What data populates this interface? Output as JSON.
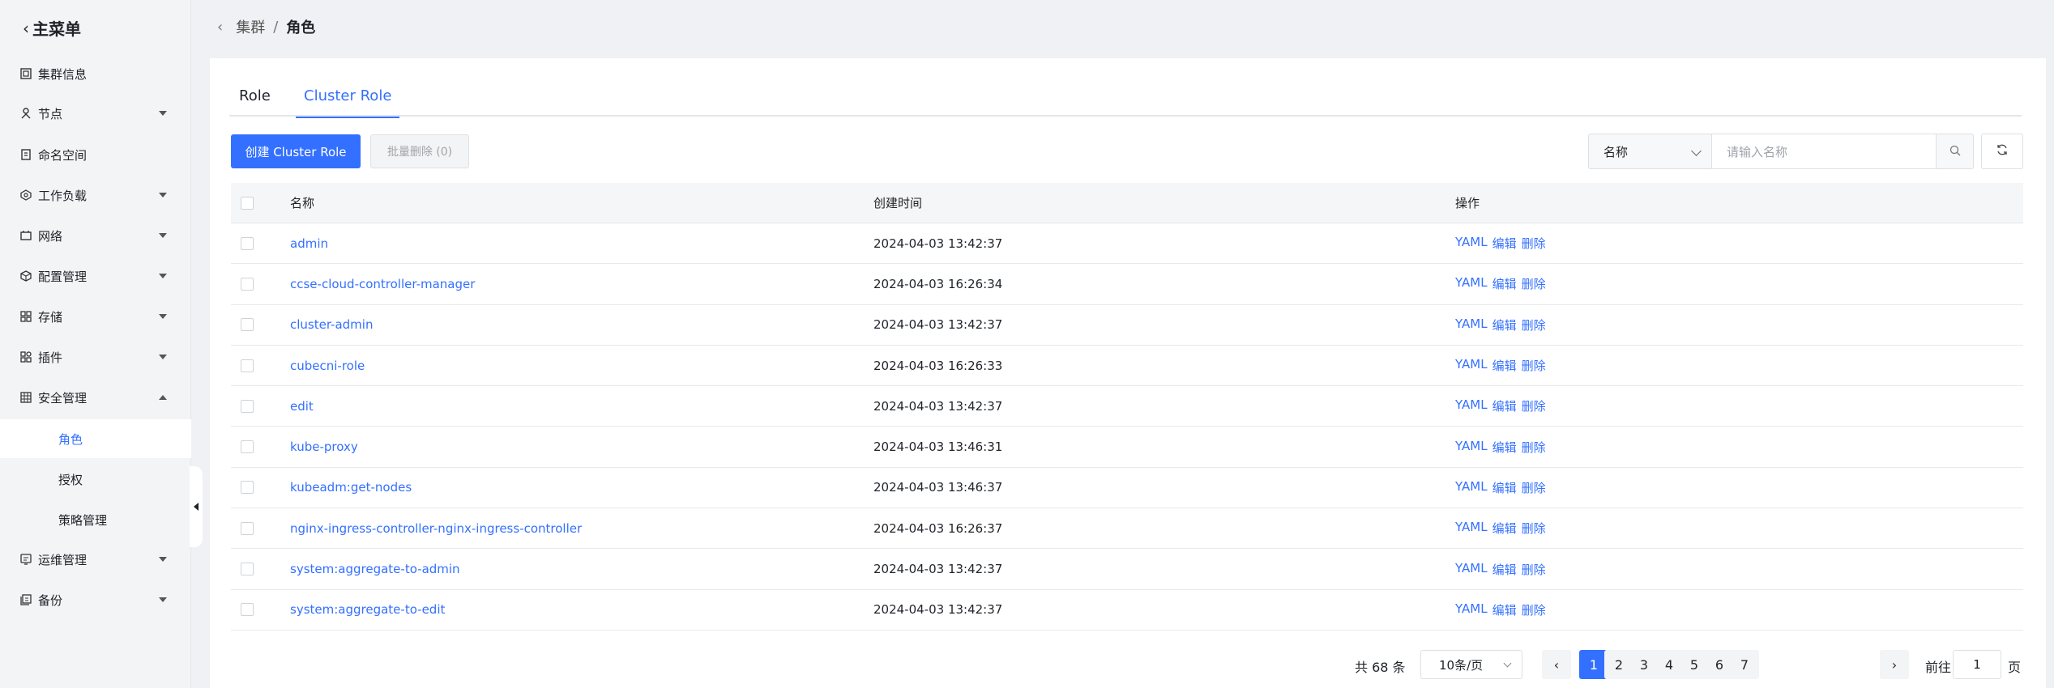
{
  "sidebar": {
    "back_label": "主菜单",
    "items": [
      {
        "label": "集群信息",
        "icon": "cluster-icon",
        "expandable": false
      },
      {
        "label": "节点",
        "icon": "node-icon",
        "expandable": true
      },
      {
        "label": "命名空间",
        "icon": "namespace-icon",
        "expandable": false
      },
      {
        "label": "工作负载",
        "icon": "workload-icon",
        "expandable": true
      },
      {
        "label": "网络",
        "icon": "network-icon",
        "expandable": true
      },
      {
        "label": "配置管理",
        "icon": "config-icon",
        "expandable": true
      },
      {
        "label": "存储",
        "icon": "storage-icon",
        "expandable": true
      },
      {
        "label": "插件",
        "icon": "plugin-icon",
        "expandable": true
      },
      {
        "label": "安全管理",
        "icon": "security-icon",
        "expandable": true,
        "expanded": true
      },
      {
        "label": "运维管理",
        "icon": "ops-icon",
        "expandable": true
      },
      {
        "label": "备份",
        "icon": "backup-icon",
        "expandable": true
      }
    ],
    "security_sub": [
      {
        "label": "角色",
        "active": true
      },
      {
        "label": "授权",
        "active": false
      },
      {
        "label": "策略管理",
        "active": false
      }
    ]
  },
  "breadcrumb": {
    "parent": "集群",
    "separator": "/",
    "current": "角色"
  },
  "tabs": [
    {
      "label": "Role",
      "active": false
    },
    {
      "label": "Cluster Role",
      "active": true
    }
  ],
  "toolbar": {
    "create_label": "创建 Cluster Role",
    "batch_delete_label": "批量删除 (0)",
    "filter_select_value": "名称",
    "search_placeholder": "请输入名称"
  },
  "table": {
    "headers": {
      "name": "名称",
      "created": "创建时间",
      "actions": "操作"
    },
    "action_labels": {
      "yaml": "YAML",
      "edit": "编辑",
      "delete": "删除"
    },
    "rows": [
      {
        "name": "admin",
        "created": "2024-04-03 13:42:37"
      },
      {
        "name": "ccse-cloud-controller-manager",
        "created": "2024-04-03 16:26:34"
      },
      {
        "name": "cluster-admin",
        "created": "2024-04-03 13:42:37"
      },
      {
        "name": "cubecni-role",
        "created": "2024-04-03 16:26:33"
      },
      {
        "name": "edit",
        "created": "2024-04-03 13:42:37"
      },
      {
        "name": "kube-proxy",
        "created": "2024-04-03 13:46:31"
      },
      {
        "name": "kubeadm:get-nodes",
        "created": "2024-04-03 13:46:37"
      },
      {
        "name": "nginx-ingress-controller-nginx-ingress-controller",
        "created": "2024-04-03 16:26:37"
      },
      {
        "name": "system:aggregate-to-admin",
        "created": "2024-04-03 13:42:37"
      },
      {
        "name": "system:aggregate-to-edit",
        "created": "2024-04-03 13:42:37"
      }
    ]
  },
  "pagination": {
    "total_label": "共 68 条",
    "page_size_label": "10条/页",
    "pages": [
      "1",
      "2",
      "3",
      "4",
      "5",
      "6",
      "7"
    ],
    "current_page": "1",
    "goto_prefix": "前往",
    "goto_value": "1",
    "goto_suffix": "页"
  },
  "colors": {
    "accent": "#3370ff",
    "sidebar_bg": "#f3f4f6",
    "page_bg": "#f0f1f4"
  }
}
